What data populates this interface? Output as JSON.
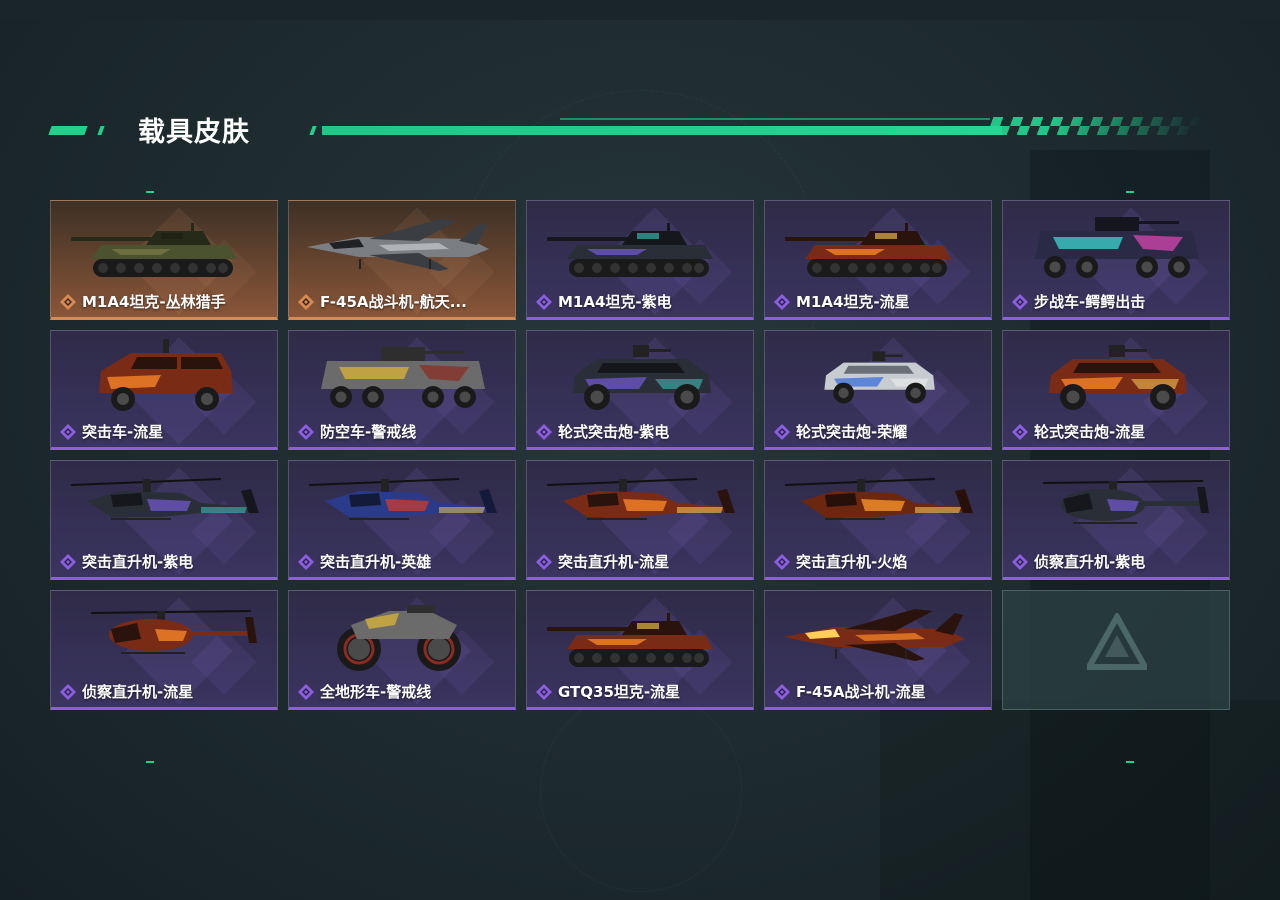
{
  "title": "载具皮肤",
  "colors": {
    "accent": "#21d08a",
    "rarity_epic": "#8b5fe0",
    "rarity_legendary": "#d98a52"
  },
  "cards": [
    {
      "name": "M1A4坦克-丛林猎手",
      "rarity": "legendary",
      "vehicle": "tank",
      "skin": "jungle"
    },
    {
      "name": "F-45A战斗机-航天...",
      "rarity": "legendary",
      "vehicle": "jet",
      "skin": "space"
    },
    {
      "name": "M1A4坦克-紫电",
      "rarity": "epic",
      "vehicle": "tank",
      "skin": "violet"
    },
    {
      "name": "M1A4坦克-流星",
      "rarity": "epic",
      "vehicle": "tank",
      "skin": "meteor"
    },
    {
      "name": "步战车-鳄鳄出击",
      "rarity": "epic",
      "vehicle": "ifv",
      "skin": "graffiti"
    },
    {
      "name": "突击车-流星",
      "rarity": "epic",
      "vehicle": "assault_car",
      "skin": "meteor"
    },
    {
      "name": "防空车-警戒线",
      "rarity": "epic",
      "vehicle": "ifv",
      "skin": "caution"
    },
    {
      "name": "轮式突击炮-紫电",
      "rarity": "epic",
      "vehicle": "armored_car",
      "skin": "violet"
    },
    {
      "name": "轮式突击炮-荣耀",
      "rarity": "epic",
      "vehicle": "armored_car_small",
      "skin": "glory"
    },
    {
      "name": "轮式突击炮-流星",
      "rarity": "epic",
      "vehicle": "armored_car",
      "skin": "meteor"
    },
    {
      "name": "突击直升机-紫电",
      "rarity": "epic",
      "vehicle": "attack_heli",
      "skin": "violet"
    },
    {
      "name": "突击直升机-英雄",
      "rarity": "epic",
      "vehicle": "attack_heli",
      "skin": "hero"
    },
    {
      "name": "突击直升机-流星",
      "rarity": "epic",
      "vehicle": "attack_heli",
      "skin": "meteor"
    },
    {
      "name": "突击直升机-火焰",
      "rarity": "epic",
      "vehicle": "attack_heli",
      "skin": "flame"
    },
    {
      "name": "侦察直升机-紫电",
      "rarity": "epic",
      "vehicle": "scout_heli",
      "skin": "violet"
    },
    {
      "name": "侦察直升机-流星",
      "rarity": "epic",
      "vehicle": "scout_heli",
      "skin": "meteor"
    },
    {
      "name": "全地形车-警戒线",
      "rarity": "epic",
      "vehicle": "atv",
      "skin": "caution"
    },
    {
      "name": "GTQ35坦克-流星",
      "rarity": "epic",
      "vehicle": "tank",
      "skin": "meteor"
    },
    {
      "name": "F-45A战斗机-流星",
      "rarity": "epic",
      "vehicle": "jet",
      "skin": "meteor"
    },
    {
      "name": "",
      "rarity": "empty",
      "vehicle": "",
      "skin": ""
    }
  ]
}
